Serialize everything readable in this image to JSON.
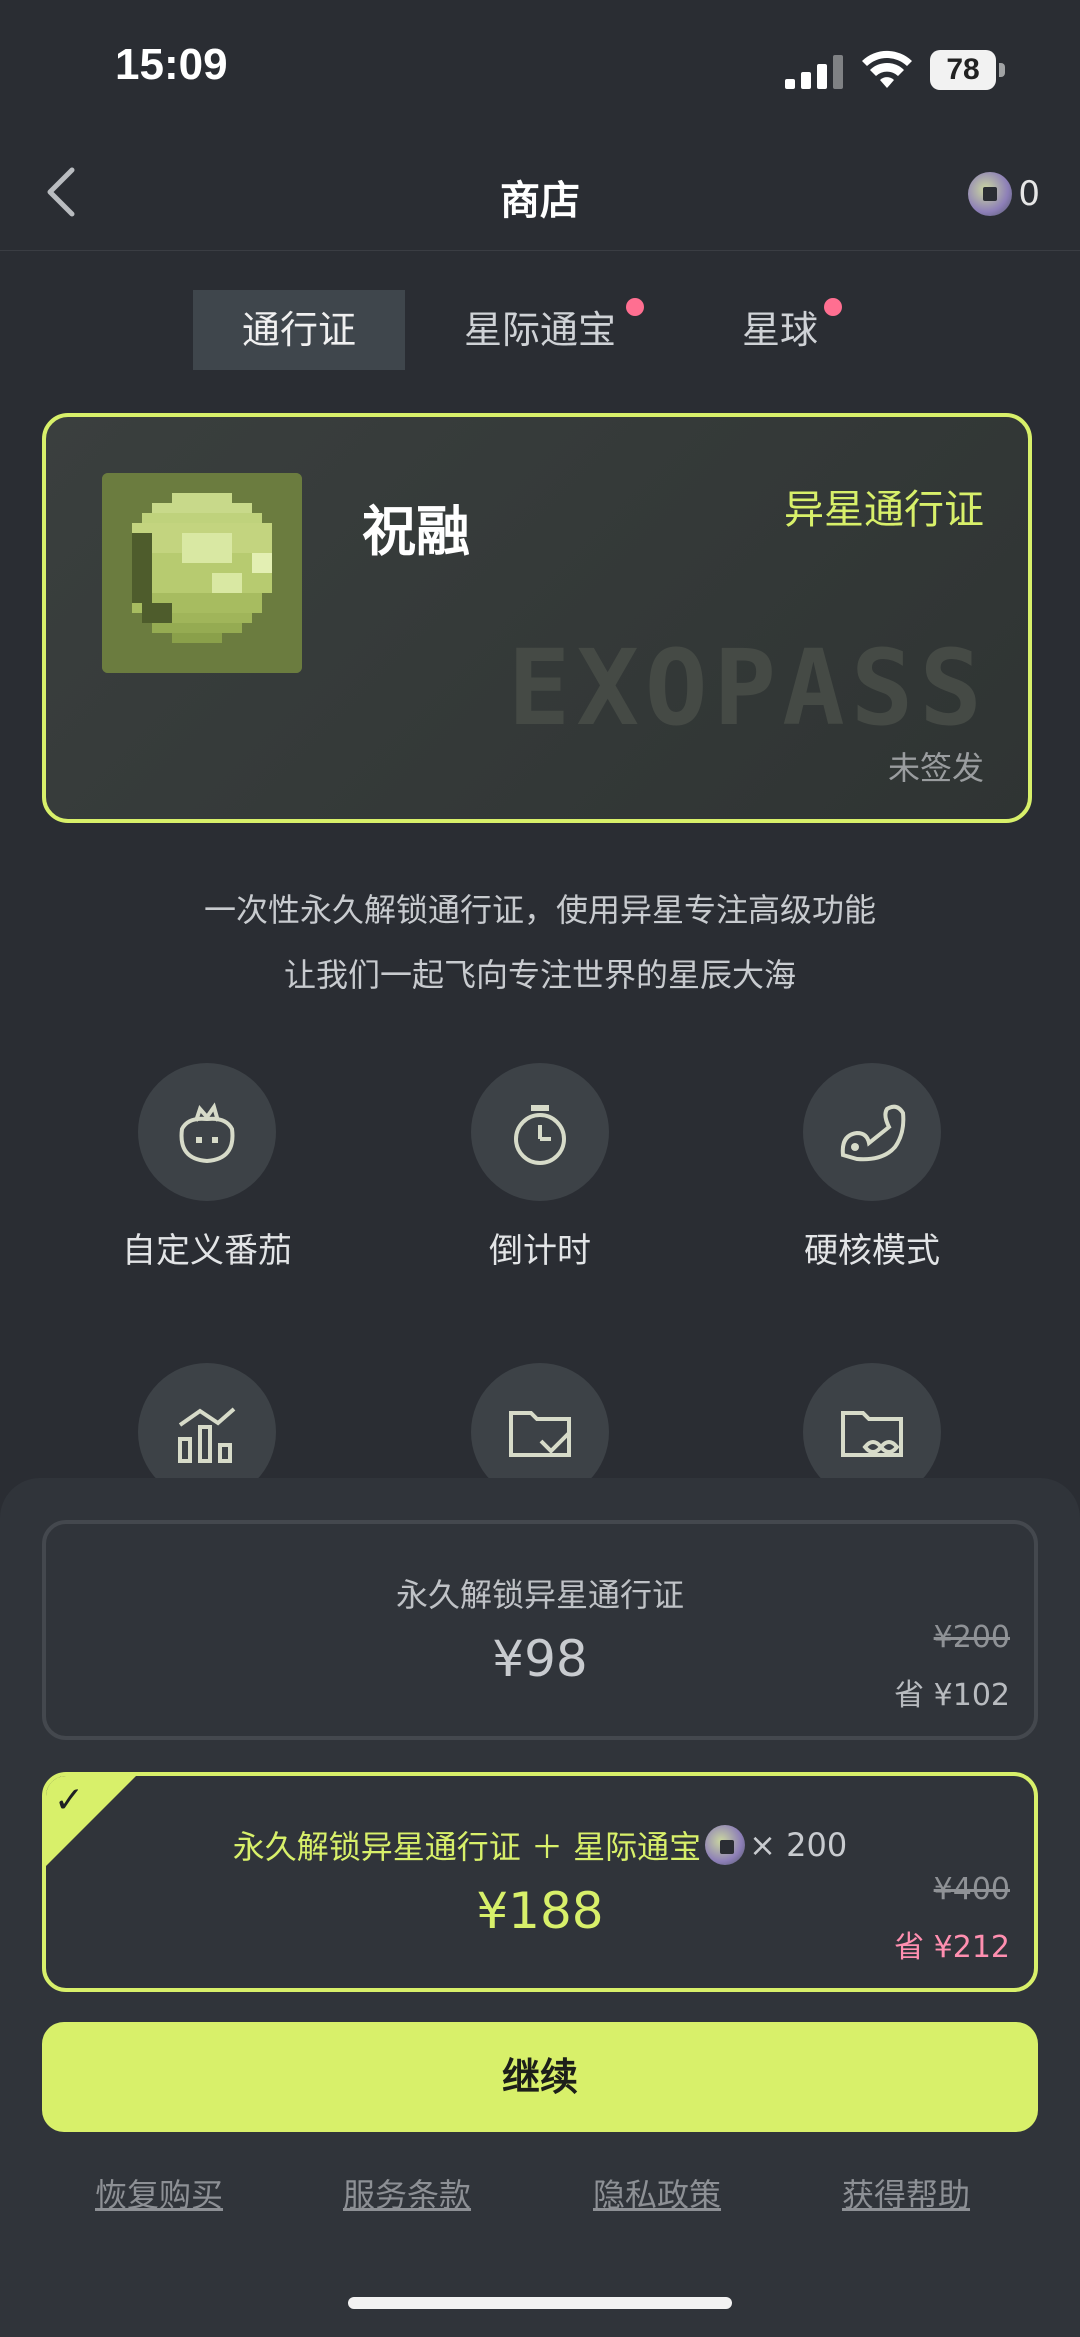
{
  "status_bar": {
    "time": "15:09",
    "battery": "78"
  },
  "nav": {
    "title": "商店",
    "coin_count": "0"
  },
  "tabs": [
    {
      "label": "通行证",
      "active": true,
      "badge": false
    },
    {
      "label": "星际通宝",
      "active": false,
      "badge": true
    },
    {
      "label": "星球",
      "active": false,
      "badge": true
    }
  ],
  "pass_card": {
    "name": "祝融",
    "type": "异星通行证",
    "watermark": "EXOPASS",
    "status": "未签发"
  },
  "description": {
    "line1": "一次性永久解锁通行证，使用异星专注高级功能",
    "line2": "让我们一起飞向专注世界的星辰大海"
  },
  "features": [
    {
      "label": "自定义番茄",
      "icon": "tomato-icon"
    },
    {
      "label": "倒计时",
      "icon": "stopwatch-icon"
    },
    {
      "label": "硬核模式",
      "icon": "flex-arm-icon"
    },
    {
      "label": "",
      "icon": "stats-icon"
    },
    {
      "label": "",
      "icon": "folder-check-icon"
    },
    {
      "label": "",
      "icon": "folder-infinity-icon"
    }
  ],
  "options": [
    {
      "title": "永久解锁异星通行证",
      "price": "¥98",
      "original": "¥200",
      "save": "省 ¥102",
      "selected": false
    },
    {
      "title": "永久解锁异星通行证 ＋ 星际通宝",
      "bonus": "× 200",
      "price": "¥188",
      "original": "¥400",
      "save": "省 ¥212",
      "selected": true
    }
  ],
  "cta": {
    "label": "继续"
  },
  "links": [
    "恢复购买",
    "服务条款",
    "隐私政策",
    "获得帮助"
  ],
  "colors": {
    "accent": "#d8f06a",
    "background": "#2a2d33",
    "sheet": "#30343a",
    "badge": "#ff6f91",
    "save_highlight": "#ff8fb0"
  }
}
